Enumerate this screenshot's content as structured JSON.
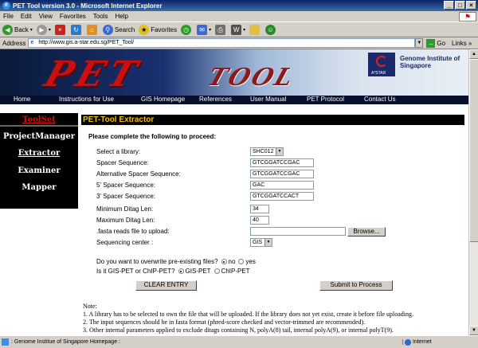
{
  "window": {
    "title": "PET Tool version 3.0 - Microsoft Internet Explorer",
    "min": "_",
    "max": "□",
    "close": "×"
  },
  "menu": [
    "File",
    "Edit",
    "View",
    "Favorites",
    "Tools",
    "Help"
  ],
  "toolbar": {
    "back": "Back",
    "search": "Search",
    "favorites": "Favorites"
  },
  "address": {
    "label": "Address",
    "url": "http://www.gis.a-star.edu.sg/PET_Tool/",
    "go": "Go",
    "links": "Links »"
  },
  "banner": {
    "pet": "PET",
    "tool": "TOOL",
    "org": "Genome Institute of Singapore",
    "astar": "A*STAR"
  },
  "nav": [
    "Home",
    "Instructions for Use",
    "GIS Homepage",
    "References",
    "User Manual",
    "PET Protocol",
    "Contact Us"
  ],
  "sidebar": [
    "ToolSet",
    "ProjectManager",
    "Extractor",
    "Examiner",
    "Mapper"
  ],
  "content": {
    "title": "PET-Tool Extractor",
    "instruction": "Please complete the following to proceed:",
    "fields": {
      "library_label": "Select a library:",
      "library_value": "SHC012",
      "spacer_label": "Spacer Sequence:",
      "spacer_value": "GTCGGATCCGAC",
      "alt_spacer_label": "Alternative Spacer Sequence:",
      "alt_spacer_value": "GTCGGATCCGAC",
      "spacer5_label": "5' Spacer Sequence:",
      "spacer5_value": "GAC",
      "spacer3_label": "3' Spacer Sequence:",
      "spacer3_value": "GTCGGATCCACT",
      "min_label": "Minimum Ditag Len:",
      "min_value": "34",
      "max_label": "Maximum Ditag Len:",
      "max_value": "40",
      "fasta_label": ".fasta reads file to upload:",
      "browse": "Browse...",
      "center_label": "Sequencing center :",
      "center_value": "GIS"
    },
    "overwrite_q": "Do you want to overwrite pre-existing files?",
    "no": "no",
    "yes": "yes",
    "type_q": "Is it GIS-PET or ChIP-PET?",
    "gis_pet": "GIS-PET",
    "chip_pet": "ChIP-PET",
    "clear": "CLEAR ENTRY",
    "submit": "Submit to Process"
  },
  "notes": {
    "heading": "Note:",
    "n1": "1. A library has to be selected to own the file that will be uploaded. If the library does not yet exist, create it before file uploading.",
    "n2": "2. The input sequences should be in fasta format (phred-score checked and vector-trimmed are recommended).",
    "n3": "3. Other internal parameters applied to exclude ditags containing N, polyA(8) tail, internal polyA(9), or internal polyT(9)."
  },
  "status": {
    "message": ": Genome Institue of Singapore Homepage :",
    "zone": "Internet"
  }
}
